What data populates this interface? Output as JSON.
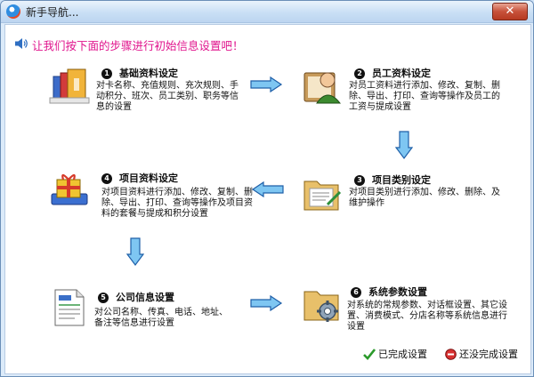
{
  "window": {
    "title": "新手导航...",
    "close_label": "✕"
  },
  "heading": "让我们按下面的步骤进行初始信息设置吧！",
  "steps": [
    {
      "num": "1",
      "title": "基础资料设定",
      "desc": "对卡名称、充值规则、充次规则、手动积分、班次、员工类别、职务等信息的设置",
      "icon": "archive-icon"
    },
    {
      "num": "2",
      "title": "员工资料设定",
      "desc": "对员工资料进行添加、修改、复制、删除、导出、打印、查询等操作及员工的工资与提成设置",
      "icon": "employee-icon"
    },
    {
      "num": "3",
      "title": "项目类别设定",
      "desc": "对项目类别进行添加、修改、删除、及维护操作",
      "icon": "folder-icon"
    },
    {
      "num": "4",
      "title": "项目资料设定",
      "desc": "对项目资料进行添加、修改、复制、删除、导出、打印、查询等操作及项目资料的套餐与提成和积分设置",
      "icon": "gift-icon"
    },
    {
      "num": "5",
      "title": "公司信息设置",
      "desc": "对公司名称、传真、电话、地址、备注等信息进行设置",
      "icon": "document-icon"
    },
    {
      "num": "6",
      "title": "系统参数设置",
      "desc": "对系统的常规参数、对话框设置、其它设置、消费模式、分店名称等系统信息进行设置",
      "icon": "settings-folder-icon"
    }
  ],
  "status": {
    "done_label": "已完成设置",
    "not_done_label": "还没完成设置"
  }
}
